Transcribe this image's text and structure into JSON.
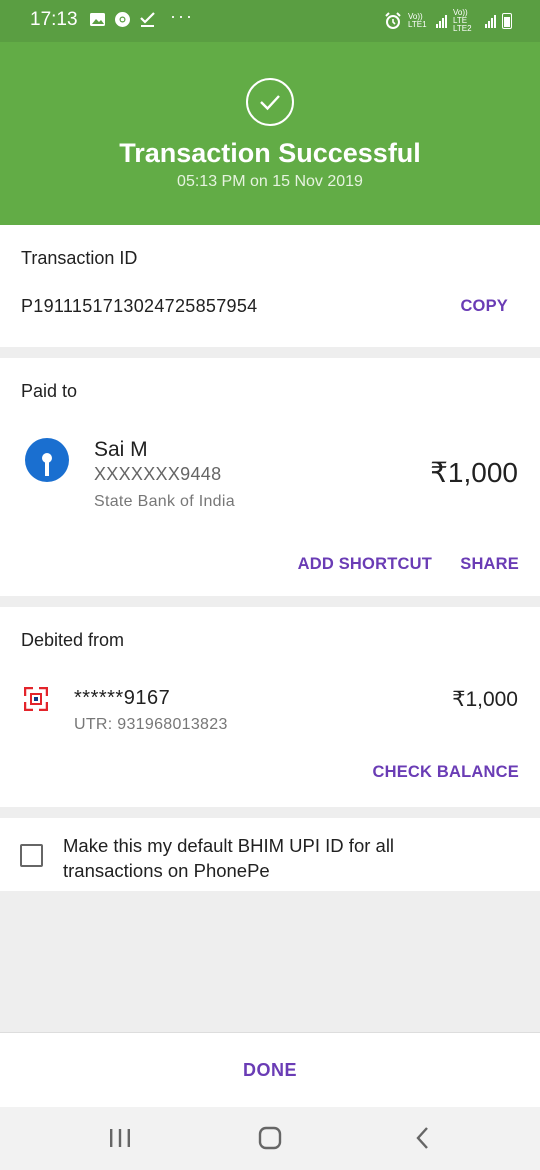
{
  "status_bar": {
    "time": "17:13",
    "icons_left": [
      "gallery-icon",
      "chrome-icon",
      "download-check-icon"
    ],
    "more": "···",
    "sim1": "Vo)) LTE1",
    "sim2": "Vo)) LTE LTE2",
    "icons_right": [
      "alarm-icon",
      "signal-icon",
      "battery-icon"
    ]
  },
  "header": {
    "title": "Transaction Successful",
    "subtitle": "05:13 PM on 15 Nov 2019",
    "icon": "check-circle-icon",
    "color": "#62ac46"
  },
  "transaction": {
    "label": "Transaction ID",
    "id": "P1911151713024725857954",
    "copy_label": "COPY"
  },
  "paid_to": {
    "label": "Paid to",
    "name": "Sai M",
    "account": "XXXXXXX9448",
    "bank": "State Bank of India",
    "amount": "₹1,000",
    "add_shortcut_label": "ADD SHORTCUT",
    "share_label": "SHARE",
    "bank_icon": "sbi-logo-icon"
  },
  "debited_from": {
    "label": "Debited from",
    "account": "******9167",
    "utr": "UTR: 931968013823",
    "amount": "₹1,000",
    "check_balance_label": "CHECK BALANCE",
    "bank_icon": "hdfc-logo-icon"
  },
  "default_upi": {
    "text": "Make this my default BHIM UPI ID for all transactions on PhonePe",
    "checked": false
  },
  "footer": {
    "done_label": "DONE"
  },
  "navbar": {
    "icons": [
      "recents-icon",
      "home-icon",
      "back-icon"
    ]
  },
  "colors": {
    "accent": "#6a3cb5",
    "success_green": "#62ac46",
    "status_green": "#5a9e42",
    "sbi_blue": "#1a6fd0",
    "hdfc_red": "#e3242b"
  }
}
